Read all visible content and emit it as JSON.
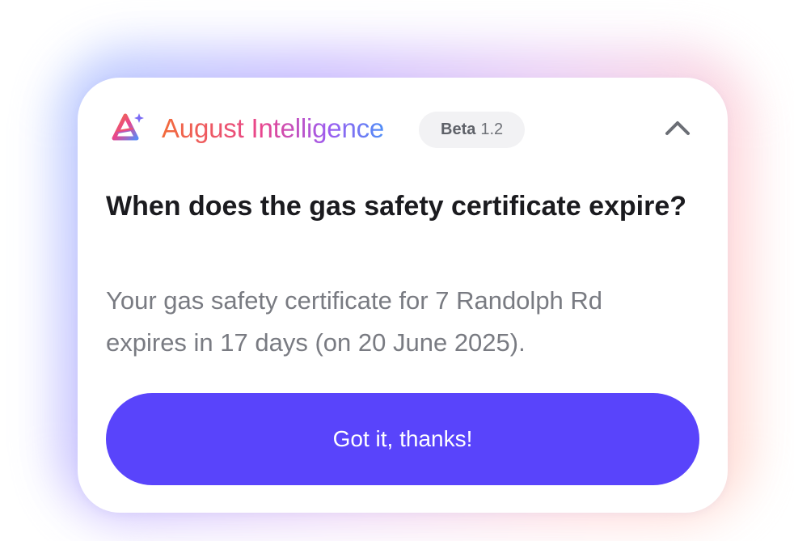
{
  "header": {
    "brand_name": "August Intelligence",
    "badge_label": "Beta",
    "badge_version": "1.2",
    "logo_icon": "august-logo-icon",
    "collapse_icon": "chevron-up-icon"
  },
  "card": {
    "question": "When does the gas safety certificate expire?",
    "answer": "Your gas safety certificate for 7 Randolph Rd expires in 17 days (on 20 June 2025).",
    "button_label": "Got it, thanks!"
  },
  "colors": {
    "primary": "#5944fb",
    "brand_gradient": [
      "#f26b3a",
      "#e8458f",
      "#9d5cf0",
      "#4f8ef7"
    ],
    "answer_text": "#797b82",
    "question_text": "#1b1b1f"
  }
}
